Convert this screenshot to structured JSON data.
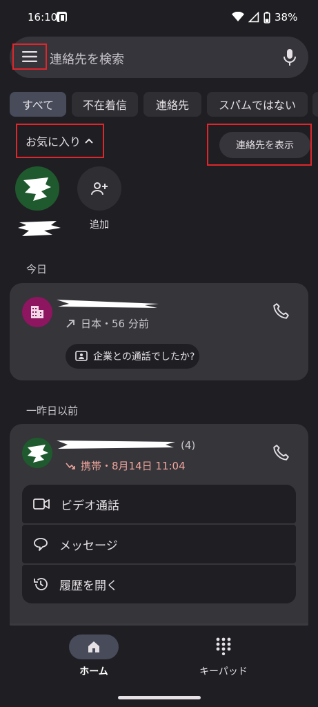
{
  "status": {
    "time": "16:10",
    "battery": "38%"
  },
  "search": {
    "placeholder": "連絡先を検索"
  },
  "chips": [
    {
      "label": "すべて"
    },
    {
      "label": "不在着信"
    },
    {
      "label": "連絡先"
    },
    {
      "label": "スパムではない"
    }
  ],
  "favorites": {
    "header": "お気に入り",
    "show_contacts": "連絡先を表示",
    "add_label": "追加"
  },
  "sections": {
    "today": "今日",
    "earlier": "一昨日以前"
  },
  "calls": [
    {
      "meta": "日本・56 分前",
      "pill": "企業との通話でしたか?"
    },
    {
      "count": "(4)",
      "meta": "携帯・8月14日 11:04"
    }
  ],
  "actions": {
    "video": "ビデオ通話",
    "message": "メッセージ",
    "history": "履歴を開く"
  },
  "nav": {
    "home": "ホーム",
    "keypad": "キーパッド"
  },
  "colors": {
    "background": "#1f1f23",
    "card": "#35353a",
    "highlight": "#e0262b",
    "missed": "#f0a59d",
    "business_avatar": "#8e1560",
    "contact_avatar": "#1f5a2e"
  }
}
